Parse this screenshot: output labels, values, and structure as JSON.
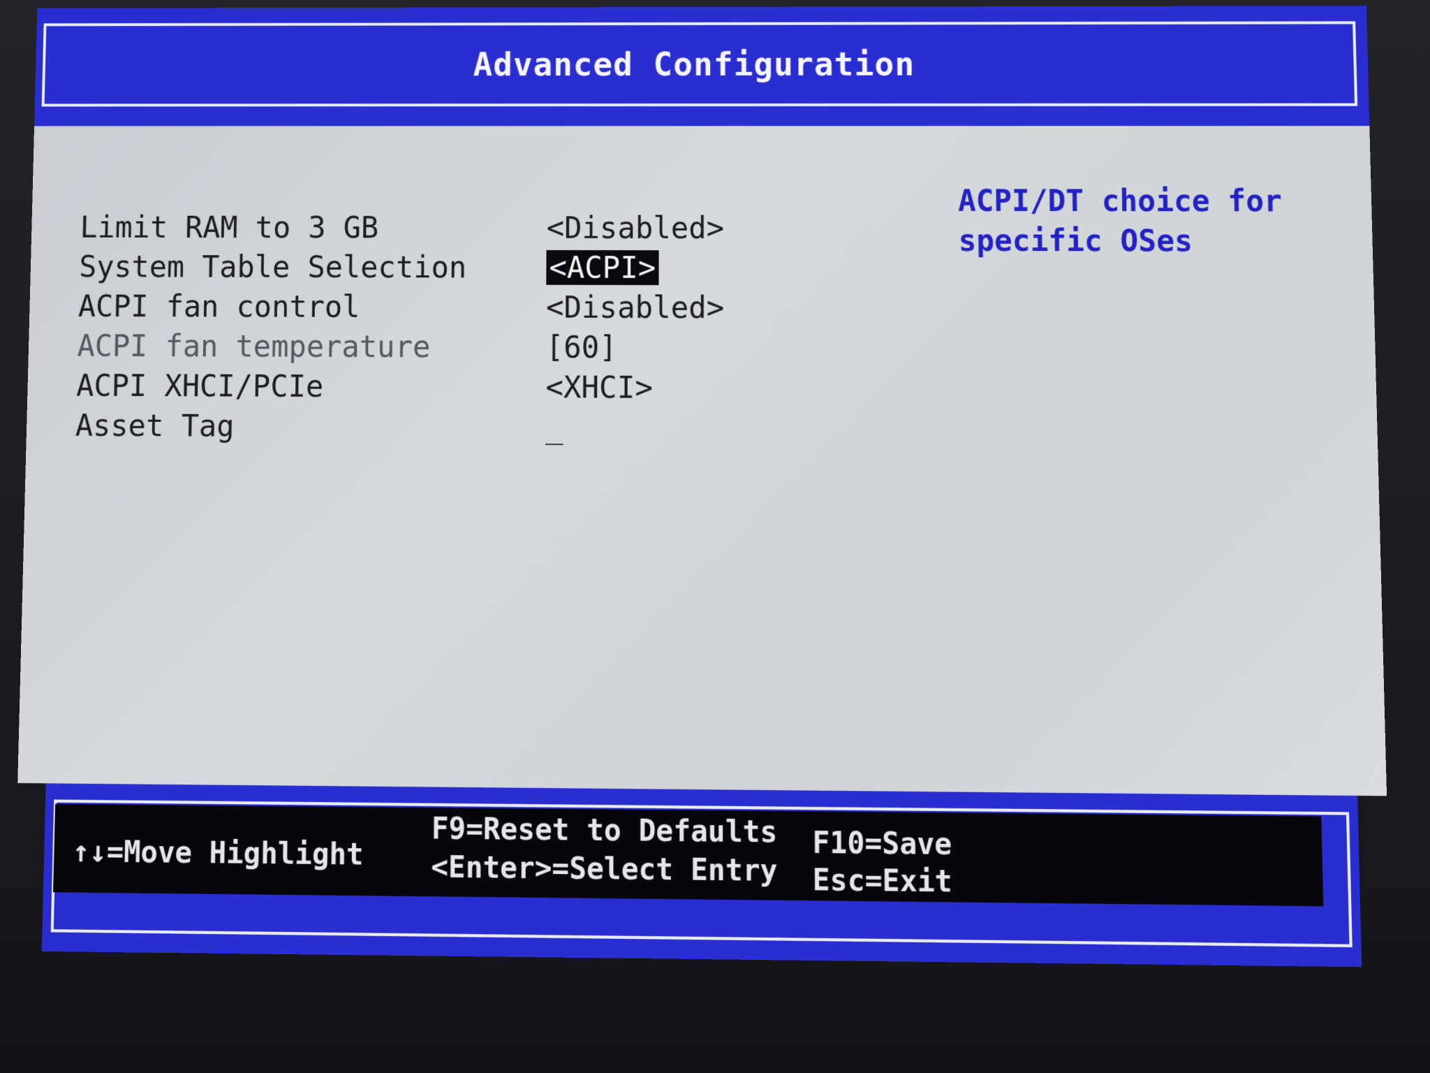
{
  "header": {
    "title": "Advanced Configuration"
  },
  "settings": [
    {
      "label": "Limit RAM to 3 GB",
      "value": "<Disabled>",
      "selected": false,
      "enabled": true
    },
    {
      "label": "System Table Selection",
      "value": "<ACPI>",
      "selected": true,
      "enabled": true
    },
    {
      "label": "ACPI fan control",
      "value": "<Disabled>",
      "selected": false,
      "enabled": true
    },
    {
      "label": "ACPI fan temperature",
      "value": "[60]",
      "selected": false,
      "enabled": false
    },
    {
      "label": "ACPI XHCI/PCIe",
      "value": "<XHCI>",
      "selected": false,
      "enabled": true
    },
    {
      "label": "Asset Tag",
      "value": "_",
      "selected": false,
      "enabled": true
    }
  ],
  "help": {
    "text": "ACPI/DT choice for specific OSes"
  },
  "footer": {
    "move_hint": "↑↓=Move Highlight",
    "reset_hint": "F9=Reset to Defaults",
    "select_hint": "<Enter>=Select Entry",
    "save_hint": "F10=Save",
    "exit_hint": "Esc=Exit"
  },
  "colors": {
    "accent": "#2a2ed0",
    "panel": "#cfd3d6",
    "help_text": "#2222c4",
    "selection_bg": "#0a0a0e"
  }
}
